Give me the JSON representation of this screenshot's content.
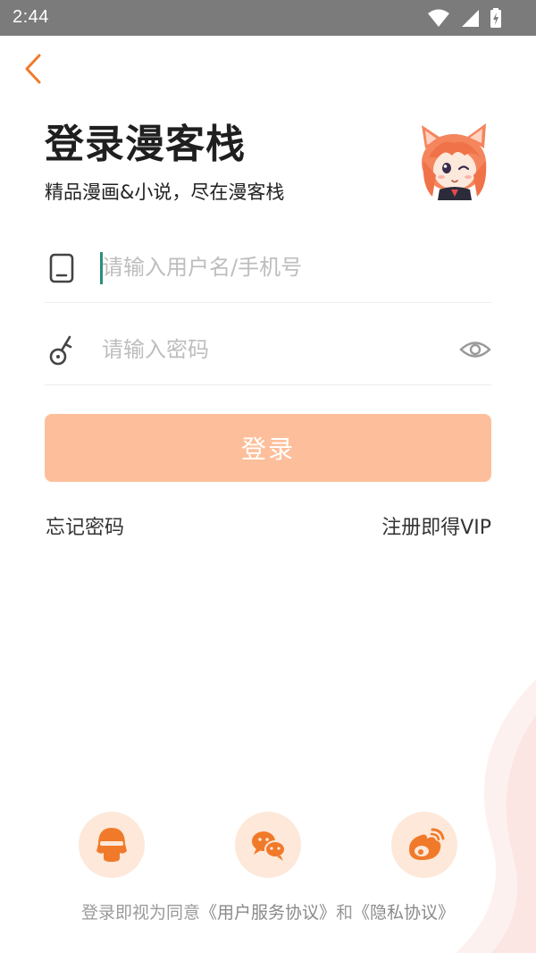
{
  "status_bar": {
    "time": "2:44",
    "icons": [
      "wifi-icon",
      "signal-icon",
      "battery-charging-icon"
    ]
  },
  "header": {
    "back_icon": "chevron-left-icon",
    "title": "登录漫客栈",
    "subtitle": "精品漫画&小说，尽在漫客栈",
    "mascot": "cat-ear-girl-mascot"
  },
  "form": {
    "username": {
      "placeholder": "请输入用户名/手机号",
      "value": "",
      "icon": "phone-icon"
    },
    "password": {
      "placeholder": "请输入密码",
      "value": "",
      "icon": "key-icon",
      "toggle_icon": "eye-icon"
    },
    "login_label": "登录",
    "forgot_label": "忘记密码",
    "register_label": "注册即得VIP"
  },
  "social": [
    {
      "name": "qq",
      "icon": "qq-icon"
    },
    {
      "name": "wechat",
      "icon": "wechat-icon"
    },
    {
      "name": "weibo",
      "icon": "weibo-icon"
    }
  ],
  "agreement": {
    "prefix": "登录即视为同意",
    "terms": "《用户服务协议》",
    "and": "和",
    "privacy": "《隐私协议》"
  },
  "colors": {
    "accent": "#f07a2a",
    "button_disabled": "#fdbf9b",
    "social_bg": "#fde8d9",
    "status_bar": "#7b7b7b",
    "cursor": "#2a8f7e"
  }
}
